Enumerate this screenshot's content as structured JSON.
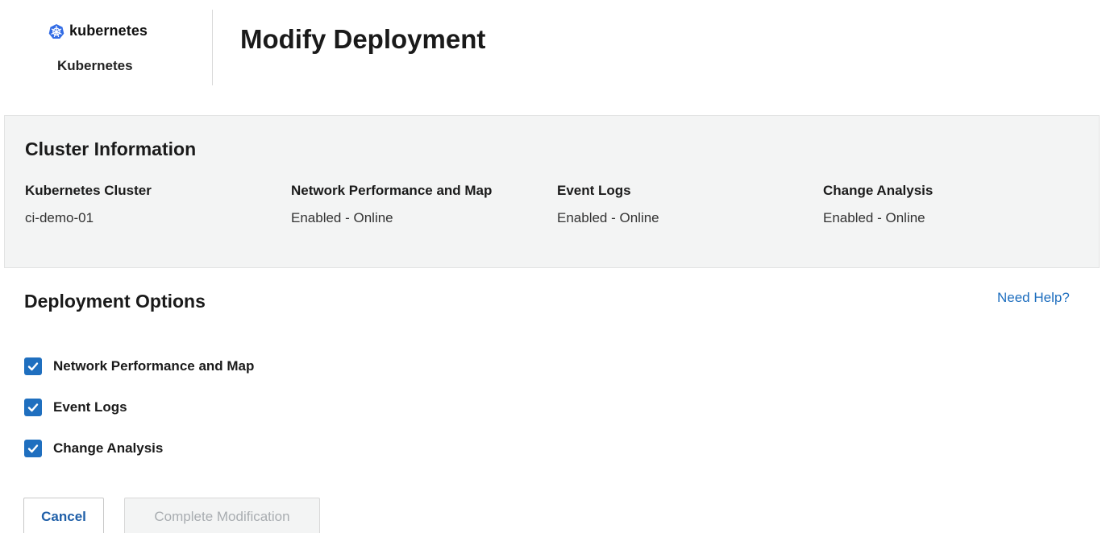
{
  "brand": {
    "logo_text": "kubernetes",
    "name": "Kubernetes",
    "icon": "kubernetes-icon"
  },
  "page": {
    "title": "Modify Deployment"
  },
  "cluster_info": {
    "title": "Cluster Information",
    "columns": [
      {
        "label": "Kubernetes Cluster",
        "value": "ci-demo-01"
      },
      {
        "label": "Network Performance and Map",
        "value": "Enabled - Online"
      },
      {
        "label": "Event Logs",
        "value": "Enabled - Online"
      },
      {
        "label": "Change Analysis",
        "value": "Enabled - Online"
      }
    ]
  },
  "deployment_options": {
    "title": "Deployment Options",
    "help_link": "Need Help?",
    "options": [
      {
        "label": "Network Performance and Map",
        "checked": true
      },
      {
        "label": "Event Logs",
        "checked": true
      },
      {
        "label": "Change Analysis",
        "checked": true
      }
    ]
  },
  "actions": {
    "cancel_label": "Cancel",
    "complete_label": "Complete Modification"
  },
  "colors": {
    "accent": "#1f6fbf",
    "panel_bg": "#f3f4f4",
    "disabled_text": "#a9adb1"
  }
}
